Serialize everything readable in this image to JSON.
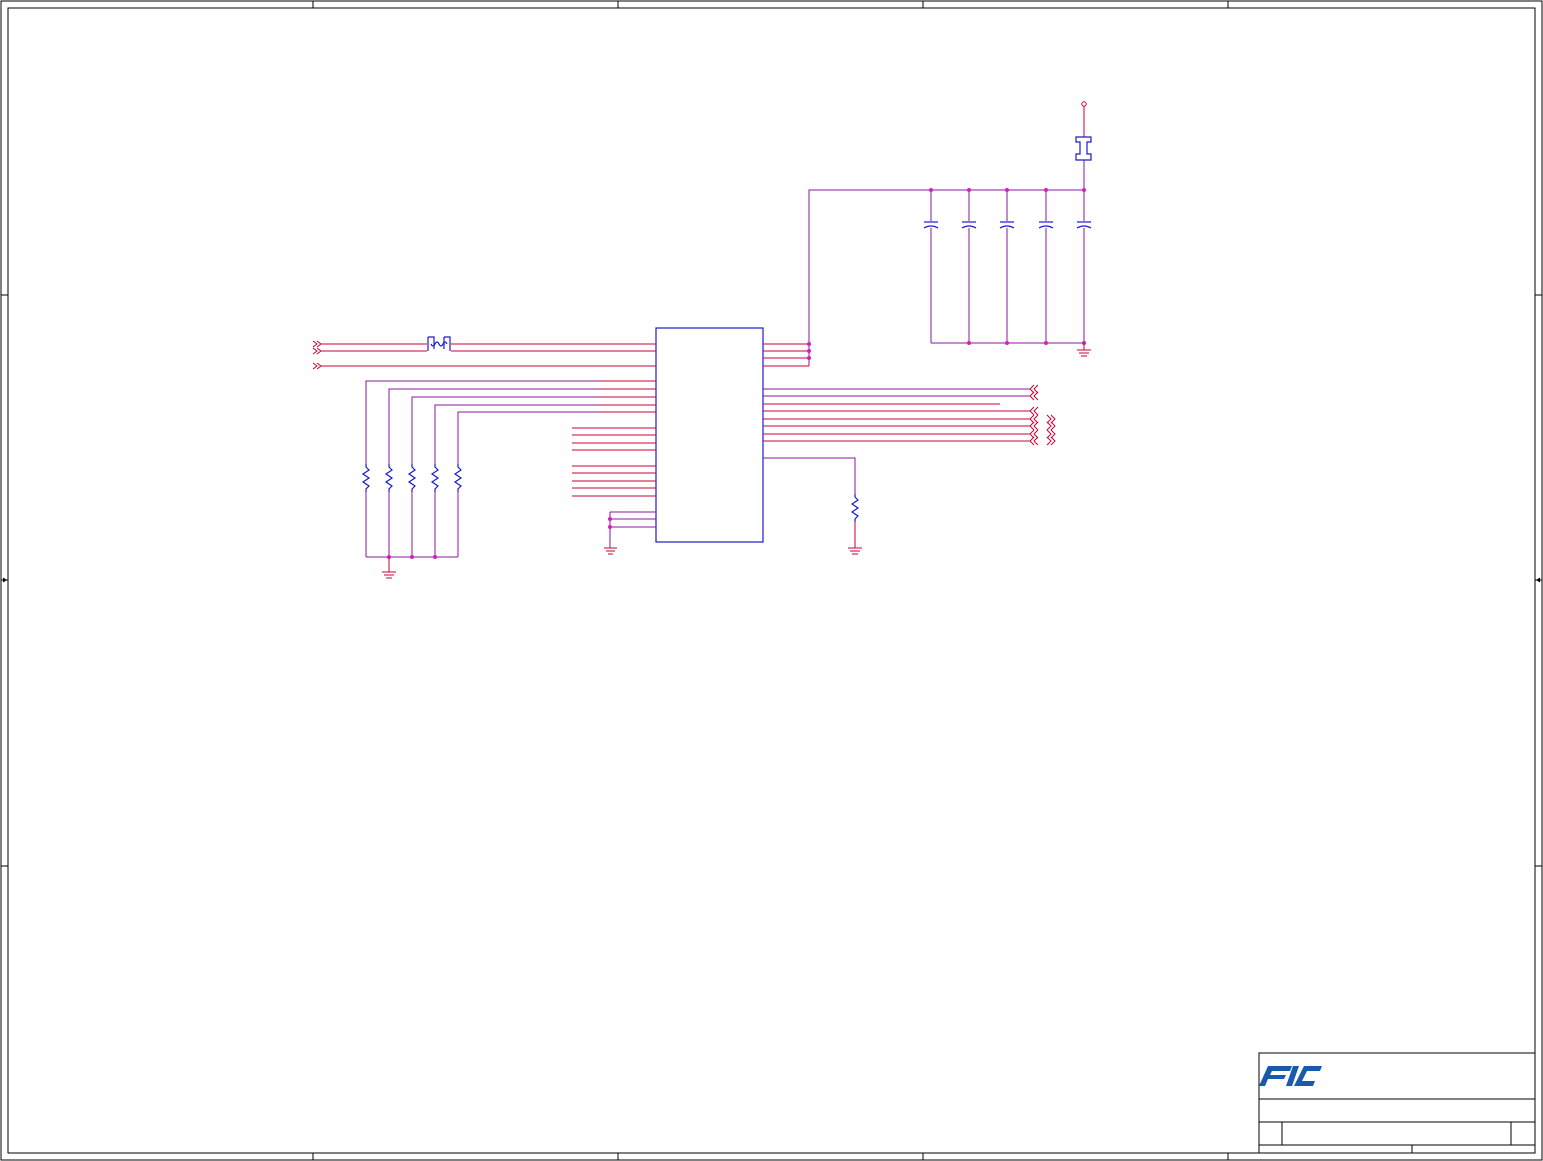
{
  "title_block": {
    "logo": "FIC",
    "logo_color": "#1a5aa8"
  },
  "colors": {
    "wire": "#cc0033",
    "power_wire": "#8a1a9e",
    "component": "#1a1acc",
    "junction": "#d020c0"
  }
}
